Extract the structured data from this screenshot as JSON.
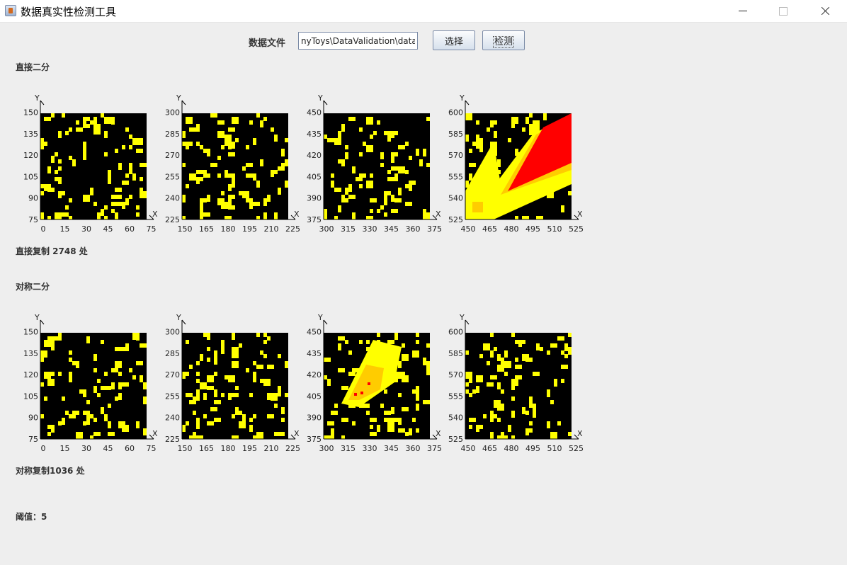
{
  "window": {
    "title": "数据真实性检测工具"
  },
  "toolbar": {
    "file_label": "数据文件",
    "file_path": "nyToys\\DataValidation\\data.csv",
    "choose_label": "选择",
    "detect_label": "检测"
  },
  "colors": {
    "background": "#000000",
    "low": "#ffff00",
    "mid": "#ffcc00",
    "high": "#ff0000"
  },
  "icons": {
    "app": "java-cup-icon",
    "minimize": "minimize-icon",
    "maximize": "maximize-icon",
    "close": "close-icon"
  },
  "sections": [
    {
      "title": "直接二分",
      "result": "直接复制 2748 处",
      "plots": [
        {
          "xticks": [
            "0",
            "15",
            "30",
            "45",
            "60",
            "75"
          ],
          "yticks": [
            "75",
            "90",
            "105",
            "120",
            "135",
            "150"
          ],
          "xlabel": "X",
          "ylabel": "Y"
        },
        {
          "xticks": [
            "150",
            "165",
            "180",
            "195",
            "210",
            "225"
          ],
          "yticks": [
            "225",
            "240",
            "255",
            "270",
            "285",
            "300"
          ],
          "xlabel": "X",
          "ylabel": "Y"
        },
        {
          "xticks": [
            "300",
            "315",
            "330",
            "345",
            "360",
            "375"
          ],
          "yticks": [
            "375",
            "390",
            "405",
            "420",
            "435",
            "450"
          ],
          "xlabel": "X",
          "ylabel": "Y"
        },
        {
          "xticks": [
            "450",
            "465",
            "480",
            "495",
            "510",
            "525"
          ],
          "yticks": [
            "525",
            "540",
            "555",
            "570",
            "585",
            "600"
          ],
          "xlabel": "X",
          "ylabel": "Y"
        }
      ]
    },
    {
      "title": "对称二分",
      "result": "对称复制1036 处",
      "plots": [
        {
          "xticks": [
            "0",
            "15",
            "30",
            "45",
            "60",
            "75"
          ],
          "yticks": [
            "75",
            "90",
            "105",
            "120",
            "135",
            "150"
          ],
          "xlabel": "X",
          "ylabel": "Y"
        },
        {
          "xticks": [
            "150",
            "165",
            "180",
            "195",
            "210",
            "225"
          ],
          "yticks": [
            "225",
            "240",
            "255",
            "270",
            "285",
            "300"
          ],
          "xlabel": "X",
          "ylabel": "Y"
        },
        {
          "xticks": [
            "300",
            "315",
            "330",
            "345",
            "360",
            "375"
          ],
          "yticks": [
            "375",
            "390",
            "405",
            "420",
            "435",
            "450"
          ],
          "xlabel": "X",
          "ylabel": "Y"
        },
        {
          "xticks": [
            "450",
            "465",
            "480",
            "495",
            "510",
            "525"
          ],
          "yticks": [
            "525",
            "540",
            "555",
            "570",
            "585",
            "600"
          ],
          "xlabel": "X",
          "ylabel": "Y"
        }
      ]
    }
  ],
  "threshold": {
    "text": "阈值：5"
  }
}
